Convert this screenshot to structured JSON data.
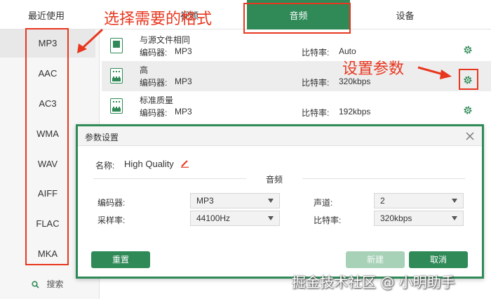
{
  "tabs": {
    "recent": "最近使用",
    "video": "视频",
    "audio": "音频",
    "device": "设备"
  },
  "sidebar": {
    "formats": [
      "MP3",
      "AAC",
      "AC3",
      "WMA",
      "WAV",
      "AIFF",
      "FLAC",
      "MKA"
    ],
    "selected_index": 0,
    "search_label": "搜索"
  },
  "quality_list": [
    {
      "name": "与源文件相同",
      "encoder_label": "编码器:",
      "encoder": "MP3",
      "bitrate_label": "比特率:",
      "bitrate": "Auto"
    },
    {
      "name": "高",
      "encoder_label": "编码器:",
      "encoder": "MP3",
      "bitrate_label": "比特率:",
      "bitrate": "320kbps"
    },
    {
      "name": "标准质量",
      "encoder_label": "编码器:",
      "encoder": "MP3",
      "bitrate_label": "比特率:",
      "bitrate": "192kbps"
    }
  ],
  "dialog": {
    "title": "参数设置",
    "name_label": "名称:",
    "name_value": "High Quality",
    "section_title": "音频",
    "encoder_label": "编码器:",
    "encoder_value": "MP3",
    "channel_label": "声道:",
    "channel_value": "2",
    "samplerate_label": "采样率:",
    "samplerate_value": "44100Hz",
    "bitrate_label": "比特率:",
    "bitrate_value": "320kbps",
    "reset_label": "重置",
    "new_label": "新建",
    "cancel_label": "取消"
  },
  "annotations": {
    "choose_format": "选择需要的格式",
    "set_params": "设置参数"
  },
  "watermark": "掘金技术社区 @ 小明助手",
  "colors": {
    "accent": "#2f8a57",
    "annotation": "#e8371f"
  }
}
